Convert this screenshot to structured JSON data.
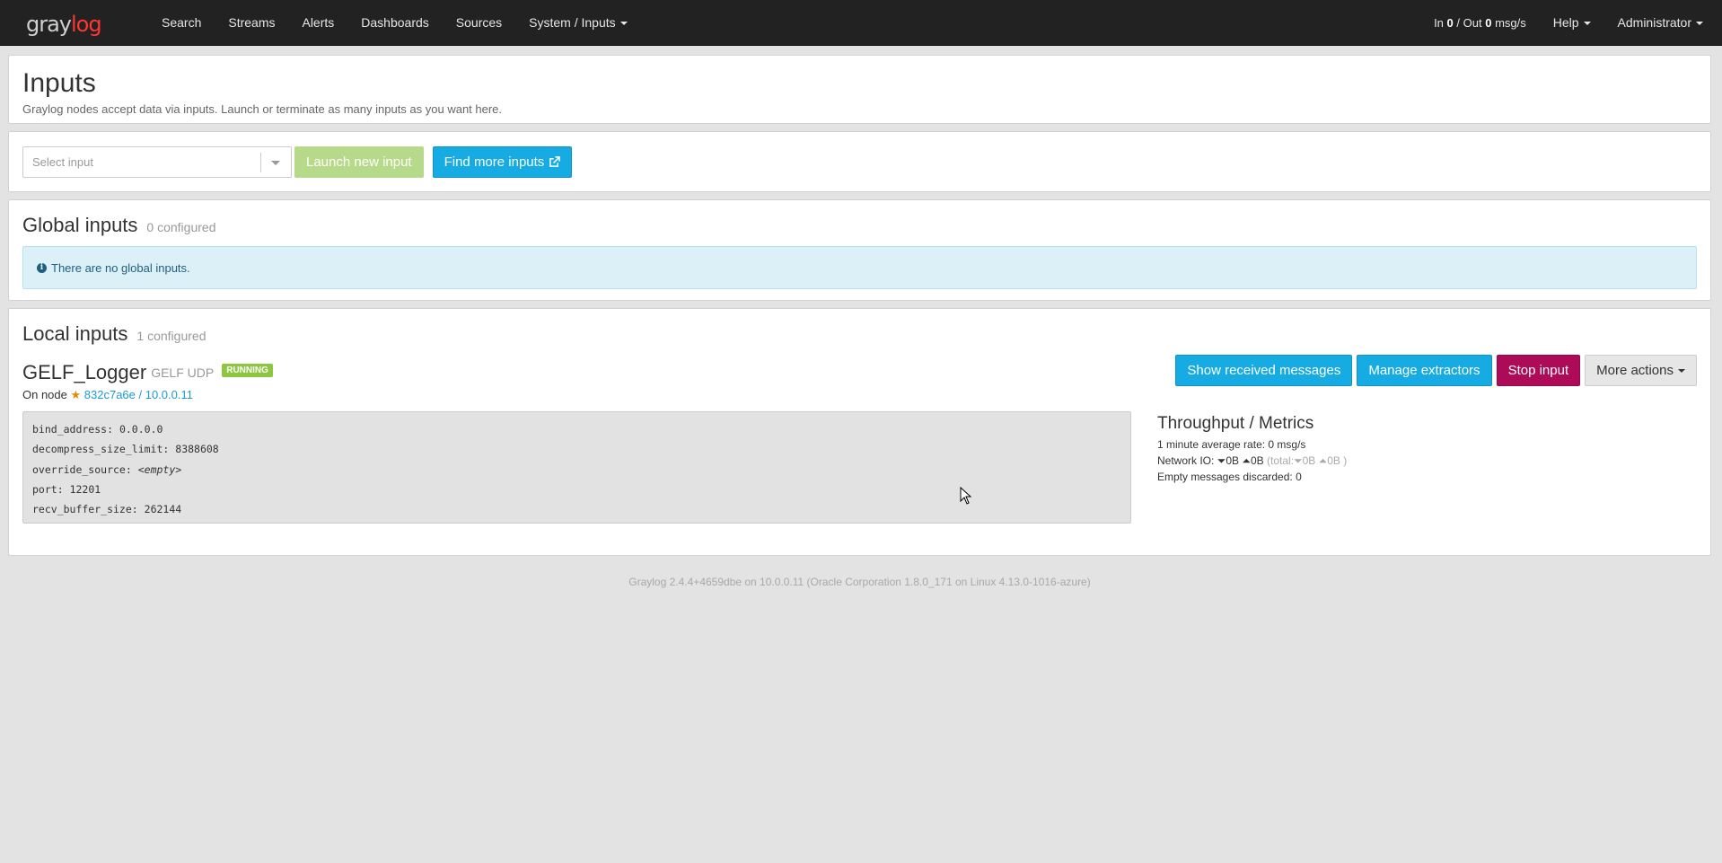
{
  "nav": {
    "brand_part1": "gray",
    "brand_part2": "log",
    "items": [
      "Search",
      "Streams",
      "Alerts",
      "Dashboards",
      "Sources"
    ],
    "system": "System / Inputs",
    "throughput": {
      "in_label": "In",
      "in_value": "0",
      "out_label": "/ Out",
      "out_value": "0",
      "unit": "msg/s"
    },
    "help": "Help",
    "user": "Administrator"
  },
  "header": {
    "title": "Inputs",
    "description": "Graylog nodes accept data via inputs. Launch or terminate as many inputs as you want here."
  },
  "launch": {
    "select_placeholder": "Select input",
    "launch_label": "Launch new input",
    "find_more_label": "Find more inputs"
  },
  "global": {
    "title": "Global inputs",
    "count": "0 configured",
    "empty_message": "There are no global inputs."
  },
  "local": {
    "title": "Local inputs",
    "count": "1 configured",
    "input": {
      "name": "GELF_Logger",
      "type": "GELF UDP",
      "state": "RUNNING",
      "on_node_label": "On node",
      "node_link": "832c7a6e / 10.0.0.11",
      "actions": {
        "show": "Show received messages",
        "extractors": "Manage extractors",
        "stop": "Stop input",
        "more": "More actions"
      },
      "config": [
        {
          "key": "bind_address:",
          "value": "0.0.0.0"
        },
        {
          "key": "decompress_size_limit:",
          "value": "8388608"
        },
        {
          "key": "override_source:",
          "value": "<empty>"
        },
        {
          "key": "port:",
          "value": "12201"
        },
        {
          "key": "recv_buffer_size:",
          "value": "262144"
        }
      ],
      "metrics": {
        "title": "Throughput / Metrics",
        "rate": "1 minute average rate: 0 msg/s",
        "network_label": "Network IO:",
        "net_in": "0B",
        "net_out": "0B",
        "total_label": "(total:",
        "total_in": "0B",
        "total_out": "0B )",
        "discarded": "Empty messages discarded: 0"
      }
    }
  },
  "footer": "Graylog 2.4.4+4659dbe on 10.0.0.11 (Oracle Corporation 1.8.0_171 on Linux 4.13.0-1016-azure)",
  "colors": {
    "navbar": "#222222",
    "brand_accent": "#ff3633",
    "info_button": "#16ace3",
    "danger_button": "#ad0b57",
    "success_badge": "#8dc63f"
  }
}
